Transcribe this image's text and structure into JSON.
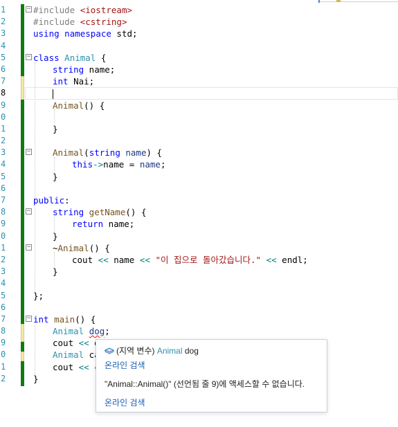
{
  "line_numbers": [
    "1",
    "2",
    "3",
    "4",
    "5",
    "6",
    "7",
    "8",
    "9",
    "0",
    "1",
    "2",
    "3",
    "4",
    "5",
    "6",
    "7",
    "8",
    "9",
    "0",
    "1",
    "2",
    "3",
    "4",
    "5",
    "6",
    "7",
    "8",
    "9",
    "0",
    "1",
    "2"
  ],
  "code": {
    "l1_prep": "#include ",
    "l1_str": "<iostream>",
    "l2_prep": "#include ",
    "l2_str": "<cstring>",
    "l3_kw1": "using",
    "l3_kw2": "namespace",
    "l3_rest": " std;",
    "l5_kw": "class",
    "l5_ty": "Animal",
    "l5_rest": " {",
    "l6_kw": "string",
    "l6_rest": " name;",
    "l7_kw": "int",
    "l7_rest": " Nai;",
    "l9_fn": "Animal",
    "l9_rest": "() {",
    "l11_rest": "}",
    "l13_fn": "Animal",
    "l13_p1": "(",
    "l13_kw": "string",
    "l13_id": " name",
    "l13_rest": ") {",
    "l14_kw": "this",
    "l14_op": "->",
    "l14_mid": "name = ",
    "l14_id": "name",
    "l14_rest": ";",
    "l15_rest": "}",
    "l17_kw": "public",
    "l17_rest": ":",
    "l18_kw": "string",
    "l18_fn": " getName",
    "l18_rest": "() {",
    "l19_kw": "return",
    "l19_rest": " name;",
    "l20_rest": "}",
    "l21_pre": "~",
    "l21_fn": "Animal",
    "l21_rest": "() {",
    "l22_a": "cout ",
    "l22_op1": "<<",
    "l22_b": " name ",
    "l22_op2": "<<",
    "l22_str": " \"이 집으로 돌아갔습니다.\"",
    "l22_op3": " <<",
    "l22_c": " endl;",
    "l23_rest": "}",
    "l25_rest": "};",
    "l27_kw": "int",
    "l27_fn": " main",
    "l27_rest": "() {",
    "l28_ty": "Animal",
    "l28_sp": " ",
    "l28_id": "dog",
    "l28_rest": ";",
    "l29_a": "cout ",
    "l29_op": "<<",
    "l29_b": " d",
    "l30_ty": "Animal",
    "l30_b": " ca",
    "l31_a": "cout ",
    "l31_op": "<<",
    "l31_b": " c",
    "l32_rest": "}"
  },
  "tooltip": {
    "scope_text": "(지역 변수) ",
    "type_text": "Animal",
    "var_text": " dog",
    "search_link_1": "온라인 검색",
    "error_message": "\"Animal::Animal()\" (선언됨 줄 9)에 액세스할 수 없습니다.",
    "search_link_2": "온라인 검색"
  },
  "icons": {
    "variable_icon": "local-variable-icon",
    "fold_collapse": "collapse-icon"
  },
  "colors": {
    "keyword": "#0000ff",
    "string": "#a31515",
    "type": "#2b91af",
    "saved_change": "#107c10",
    "link": "#1a5fb4"
  }
}
